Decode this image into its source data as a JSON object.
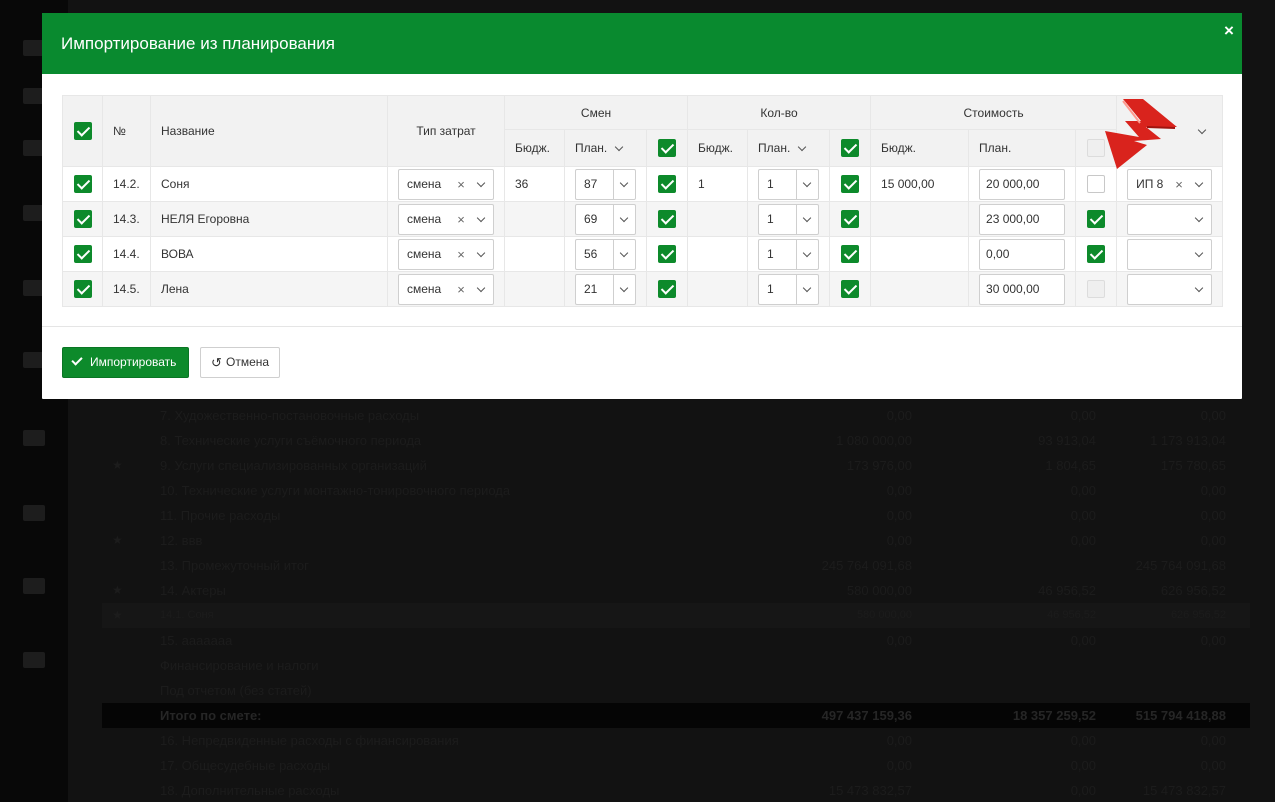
{
  "modal": {
    "title": "Импортирование из планирования",
    "close_label": "×",
    "headers": {
      "number": "№",
      "name": "Название",
      "cost_type": "Тип затрат",
      "shifts": "Смен",
      "quantity": "Кол-во",
      "cost": "Стоимость",
      "budget": "Бюдж.",
      "plan": "План."
    },
    "rows": [
      {
        "num": "14.2.",
        "name": "Соня",
        "cost_type": "смена",
        "shifts_budget": "36",
        "shifts_plan": "87",
        "qty_budget": "1",
        "qty_plan": "1",
        "cost_budget": "15 000,00",
        "cost_plan": "20 000,00",
        "vendor": "ИП 8"
      },
      {
        "num": "14.3.",
        "name": "НЕЛЯ Егоровна",
        "cost_type": "смена",
        "shifts_budget": "",
        "shifts_plan": "69",
        "qty_budget": "",
        "qty_plan": "1",
        "cost_budget": "",
        "cost_plan": "23 000,00",
        "vendor": ""
      },
      {
        "num": "14.4.",
        "name": "ВОВА",
        "cost_type": "смена",
        "shifts_budget": "",
        "shifts_plan": "56",
        "qty_budget": "",
        "qty_plan": "1",
        "cost_budget": "",
        "cost_plan": "0,00",
        "vendor": ""
      },
      {
        "num": "14.5.",
        "name": "Лена",
        "cost_type": "смена",
        "shifts_budget": "",
        "shifts_plan": "21",
        "qty_budget": "",
        "qty_plan": "1",
        "cost_budget": "",
        "cost_plan": "30 000,00",
        "vendor": ""
      }
    ],
    "import_label": "Импортировать",
    "cancel_label": "Отмена"
  },
  "background": {
    "rows": [
      {
        "name": "7. Художественно-постановочные расходы",
        "v1": "0,00",
        "v2": "0,00",
        "v3": "0,00",
        "star": ""
      },
      {
        "name": "8. Технические услуги съёмочного периода",
        "v1": "1 080 000,00",
        "v2": "93 913,04",
        "v3": "1 173 913,04",
        "star": ""
      },
      {
        "name": "9. Услуги специализированных организаций",
        "v1": "173 976,00",
        "v2": "1 804,65",
        "v3": "175 780,65",
        "star": "★"
      },
      {
        "name": "10. Технические услуги монтажно-тонировочного периода",
        "v1": "0,00",
        "v2": "0,00",
        "v3": "0,00",
        "star": ""
      },
      {
        "name": "11. Прочие расходы",
        "v1": "0,00",
        "v2": "0,00",
        "v3": "0,00",
        "star": ""
      },
      {
        "name": "12. ввв",
        "v1": "0,00",
        "v2": "0,00",
        "v3": "0,00",
        "star": "★"
      },
      {
        "name": "13. Промежуточный итог",
        "v1": "245 764 091,68",
        "v2": "",
        "v3": "245 764 091,68",
        "star": ""
      },
      {
        "name": "14. Актеры",
        "v1": "580 000,00",
        "v2": "46 956,52",
        "v3": "626 956,52",
        "star": "★"
      },
      {
        "name": "14.1. Соня",
        "v1": "580 000,00",
        "v2": "46 956,52",
        "v3": "626 956,52",
        "star": "★"
      },
      {
        "name": "15. ааааааа",
        "v1": "0,00",
        "v2": "0,00",
        "v3": "0,00",
        "star": ""
      },
      {
        "name": "Финансирование и налоги",
        "v1": "",
        "v2": "",
        "v3": "",
        "star": ""
      },
      {
        "name": "Под отчетом (без статей)",
        "v1": "",
        "v2": "",
        "v3": "",
        "star": ""
      },
      {
        "name": "Итого по смете:",
        "v1": "497 437 159,36",
        "v2": "18 357 259,52",
        "v3": "515 794 418,88",
        "star": ""
      },
      {
        "name": "16. Непредвиденные расходы с финансирования",
        "v1": "0,00",
        "v2": "0,00",
        "v3": "0,00",
        "star": ""
      },
      {
        "name": "17. Общесудебные расходы",
        "v1": "0,00",
        "v2": "0,00",
        "v3": "0,00",
        "star": ""
      },
      {
        "name": "18. Дополнительные расходы",
        "v1": "15 473 832,57",
        "v2": "0,00",
        "v3": "15 473 832,57",
        "star": ""
      }
    ]
  },
  "colors": {
    "header_green": "#098a2f",
    "checkbox_green": "#0d8a2b",
    "arrow_red": "#d9231d"
  },
  "icons": {
    "close": "close-icon",
    "check": "check-icon",
    "undo": "undo-icon",
    "chevron": "chevron-down-icon",
    "arrow": "red-arrow-icon"
  }
}
